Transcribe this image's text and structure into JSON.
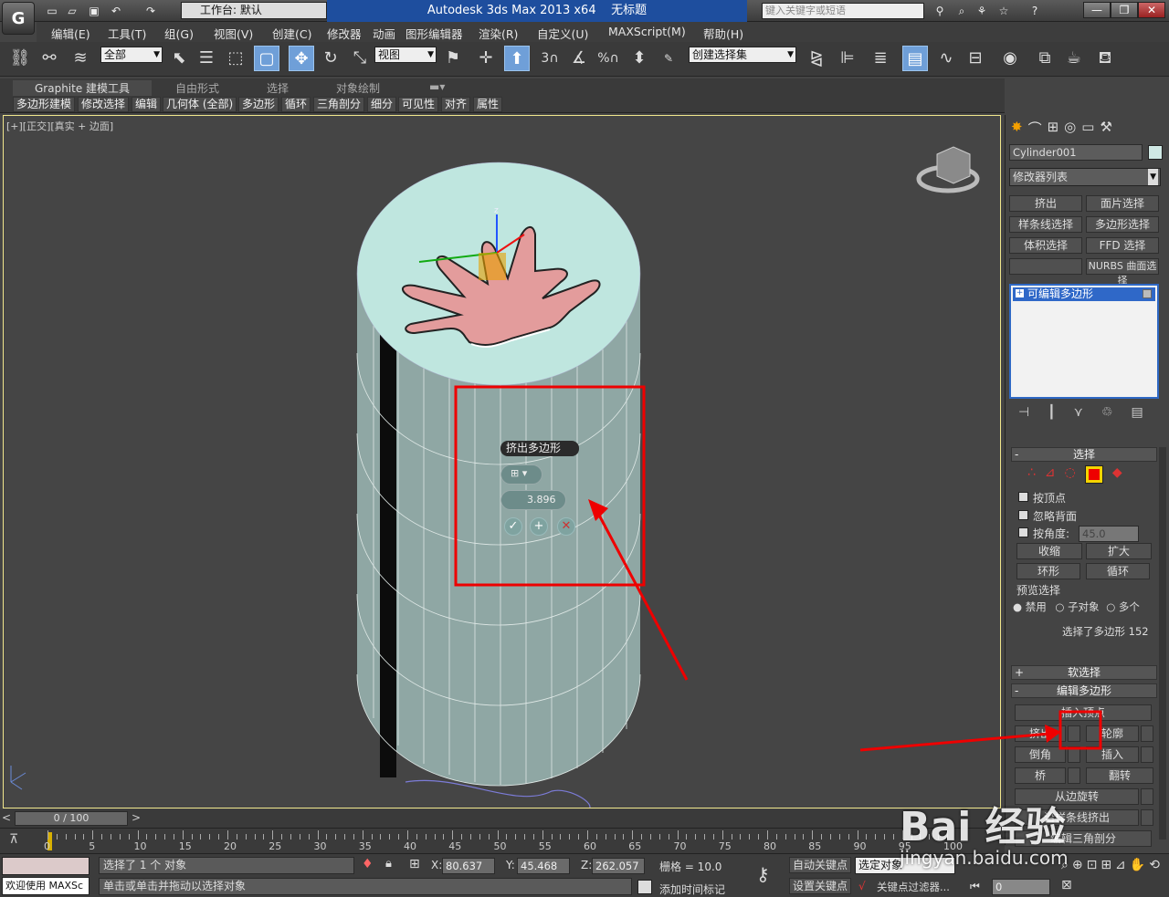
{
  "titlebar": {
    "workspace_label": "工作台: 默认",
    "app_title": "Autodesk 3ds Max  2013 x64",
    "doc_title": "无标题",
    "search_placeholder": "键入关键字或短语"
  },
  "menubar": {
    "items": [
      "编辑(E)",
      "工具(T)",
      "组(G)",
      "视图(V)",
      "创建(C)",
      "修改器",
      "动画",
      "图形编辑器",
      "渲染(R)",
      "自定义(U)",
      "MAXScript(M)",
      "帮助(H)"
    ]
  },
  "toolbar": {
    "filter_value": "全部",
    "refcoord_value": "视图",
    "selset_value": "创建选择集",
    "snap3": "3",
    "pct": "%"
  },
  "ribbon": {
    "tabs": [
      "Graphite 建模工具",
      "自由形式",
      "选择",
      "对象绘制"
    ],
    "buttons": [
      "多边形建模",
      "修改选择",
      "编辑",
      "几何体 (全部)",
      "多边形",
      "循环",
      "三角剖分",
      "细分",
      "可见性",
      "对齐",
      "属性"
    ]
  },
  "viewport": {
    "label": "[+][正交][真实 + 边面]",
    "caddy_title": "挤出多边形",
    "caddy_value": "3.896"
  },
  "command_panel": {
    "object_name": "Cylinder001",
    "modifier_list": "修改器列表",
    "mod_buttons": [
      "挤出",
      "面片选择",
      "样条线选择",
      "多边形选择",
      "体积选择",
      "FFD 选择",
      "",
      "NURBS 曲面选择"
    ],
    "stack_item": "可编辑多边形",
    "selection_title": "选择",
    "by_vertex": "按顶点",
    "ignore_backface": "忽略背面",
    "by_angle": "按角度:",
    "angle_value": "45.0",
    "shrink": "收缩",
    "grow": "扩大",
    "ring": "环形",
    "loop": "循环",
    "preview_label": "预览选择",
    "preview_off": "禁用",
    "preview_sub": "子对象",
    "preview_multi": "多个",
    "selected_info": "选择了多边形 152",
    "soft_sel": "软选择",
    "edit_poly": "编辑多边形",
    "insert_vertex": "插入顶点",
    "extrude": "挤出",
    "outline": "轮廓",
    "bevel": "倒角",
    "inset": "插入",
    "bridge": "桥",
    "flip": "翻转",
    "hinge": "从边旋转",
    "extrude_along": "沿样条线挤出",
    "edit_tri": "编辑三角剖分"
  },
  "timeline": {
    "frame": "0 / 100",
    "ticks": [
      "0",
      "5",
      "10",
      "15",
      "20",
      "25",
      "30",
      "35",
      "40",
      "45",
      "50",
      "55",
      "60",
      "65",
      "70",
      "75",
      "80",
      "85",
      "90",
      "95",
      "100"
    ]
  },
  "status": {
    "selected": "选择了 1 个 对象",
    "hint": "单击或单击并拖动以选择对象",
    "welcome": "欢迎使用 MAXSc",
    "x_label": "X:",
    "x": "80.637",
    "y_label": "Y:",
    "y": "45.468",
    "z_label": "Z:",
    "z": "262.057",
    "grid": "栅格 = 10.0",
    "add_tag": "添加时间标记",
    "auto_key": "自动关键点",
    "set_key": "设置关键点",
    "sel_object": "选定对象",
    "key_filter": "关键点过滤器...",
    "frame_field": "0"
  },
  "watermark": {
    "brand": "Bai  经验",
    "url": "jingyan.baidu.com"
  },
  "colors": {
    "app_title_bg": "#1e4e9e",
    "cylinder": "#8fa7a4",
    "cylinder_top": "#bfe6df",
    "hand": "#e39c9c",
    "annotation": "#e00000"
  }
}
